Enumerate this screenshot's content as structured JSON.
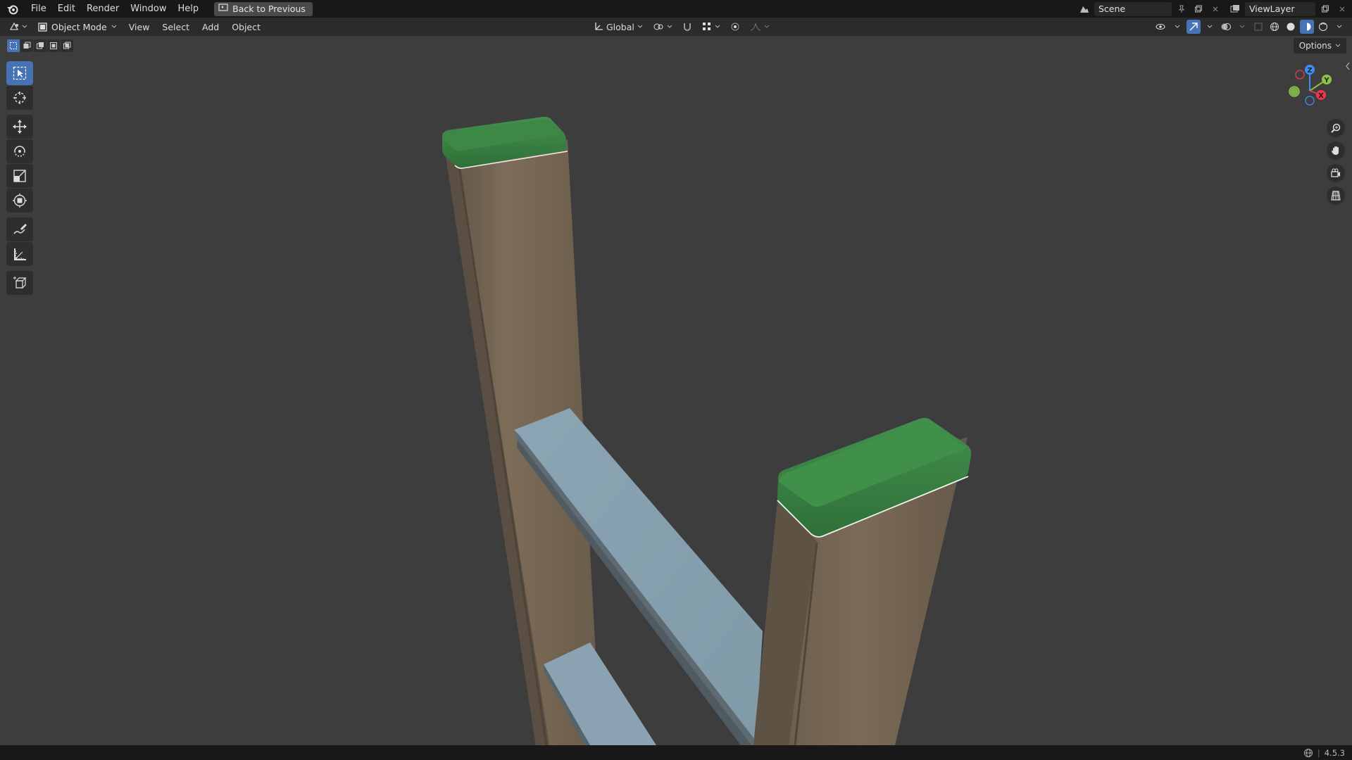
{
  "menu": {
    "items": [
      "File",
      "Edit",
      "Render",
      "Window",
      "Help"
    ],
    "back_label": "Back to Previous"
  },
  "top_right": {
    "scene_name": "Scene",
    "view_layer": "ViewLayer"
  },
  "header": {
    "mode": "Object Mode",
    "menus": [
      "View",
      "Select",
      "Add",
      "Object"
    ],
    "transform_orientation": "Global"
  },
  "viewport": {
    "options_label": "Options",
    "gizmo_axes": [
      "Z",
      "Y",
      "X"
    ]
  },
  "status": {
    "version": "4.5.3"
  },
  "colors": {
    "accent": "#4772b3",
    "post_wood": "#7a6a58",
    "post_cap": "#3b8a45",
    "plank": "#8aa2b1",
    "axis_x": "#e8384f",
    "axis_y": "#8bc34a",
    "axis_z": "#3d8ef0"
  }
}
